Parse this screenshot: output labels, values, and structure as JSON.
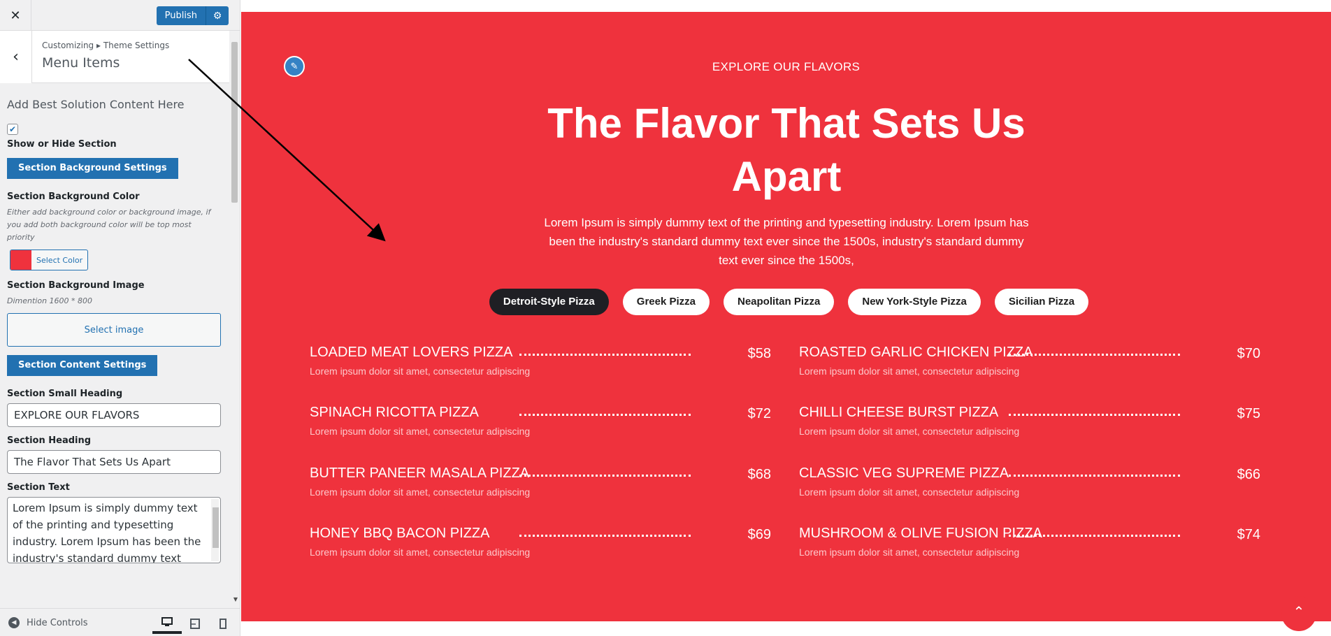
{
  "sidebar": {
    "close_icon": "✕",
    "publish_label": "Publish",
    "publish_settings_icon": "⚙",
    "back_icon": "‹",
    "breadcrumb": "Customizing ▸ Theme Settings",
    "panel_title": "Menu Items",
    "description_title": "Add Best Solution Content Here",
    "show_hide_checked": true,
    "show_hide_label": "Show or Hide Section",
    "bg_settings_button": "Section Background Settings",
    "bg_color_label": "Section Background Color",
    "bg_color_note": "Either add background color or background image, if you add both background color will be top most priority",
    "select_color_label": "Select Color",
    "selected_color": "#ef323d",
    "bg_image_label": "Section Background Image",
    "bg_image_note": "Dimention 1600 * 800",
    "select_image_label": "Select image",
    "content_settings_button": "Section Content Settings",
    "small_heading_label": "Section Small Heading",
    "small_heading_value": "EXPLORE OUR FLAVORS",
    "heading_label": "Section Heading",
    "heading_value": "The Flavor That Sets Us Apart",
    "text_label": "Section Text",
    "text_value": "Lorem Ipsum is simply dummy text of the printing and typesetting industry. Lorem Ipsum has been the industry's standard dummy text ever since the 1500s, industry's standard dummy text ever since the 1500s,",
    "hide_controls_label": "Hide Controls",
    "devices": [
      {
        "name": "desktop",
        "icon": "desktop-icon",
        "active": true
      },
      {
        "name": "tablet",
        "icon": "tablet-icon",
        "active": false
      },
      {
        "name": "mobile",
        "icon": "mobile-icon",
        "active": false
      }
    ]
  },
  "preview": {
    "background_color": "#ef323d",
    "small_heading": "EXPLORE OUR FLAVORS",
    "heading": "The Flavor That Sets Us Apart",
    "text": "Lorem Ipsum is simply dummy text of the printing and typesetting industry. Lorem Ipsum has been the industry's standard dummy text ever since the 1500s, industry's standard dummy text ever since the 1500s,",
    "tabs": [
      {
        "label": "Detroit-Style Pizza",
        "active": true
      },
      {
        "label": "Greek Pizza",
        "active": false
      },
      {
        "label": "Neapolitan Pizza",
        "active": false
      },
      {
        "label": "New York-Style Pizza",
        "active": false
      },
      {
        "label": "Sicilian Pizza",
        "active": false
      }
    ],
    "menu_items": [
      {
        "name": "LOADED MEAT LOVERS PIZZA",
        "price": "$58",
        "desc": "Lorem ipsum dolor sit amet, consectetur adipiscing"
      },
      {
        "name": "ROASTED GARLIC CHICKEN PIZZA",
        "price": "$70",
        "desc": "Lorem ipsum dolor sit amet, consectetur adipiscing"
      },
      {
        "name": "SPINACH RICOTTA PIZZA",
        "price": "$72",
        "desc": "Lorem ipsum dolor sit amet, consectetur adipiscing"
      },
      {
        "name": "CHILLI CHEESE BURST PIZZA",
        "price": "$75",
        "desc": "Lorem ipsum dolor sit amet, consectetur adipiscing"
      },
      {
        "name": "BUTTER PANEER MASALA PIZZA",
        "price": "$68",
        "desc": "Lorem ipsum dolor sit amet, consectetur adipiscing"
      },
      {
        "name": "CLASSIC VEG SUPREME PIZZA",
        "price": "$66",
        "desc": "Lorem ipsum dolor sit amet, consectetur adipiscing"
      },
      {
        "name": "HONEY BBQ BACON PIZZA",
        "price": "$69",
        "desc": "Lorem ipsum dolor sit amet, consectetur adipiscing"
      },
      {
        "name": "MUSHROOM & OLIVE FUSION PIZZA",
        "price": "$74",
        "desc": "Lorem ipsum dolor sit amet, consectetur adipiscing"
      }
    ],
    "edit_icon": "pencil-icon",
    "scroll_top_icon": "double-chevron-up-icon"
  }
}
